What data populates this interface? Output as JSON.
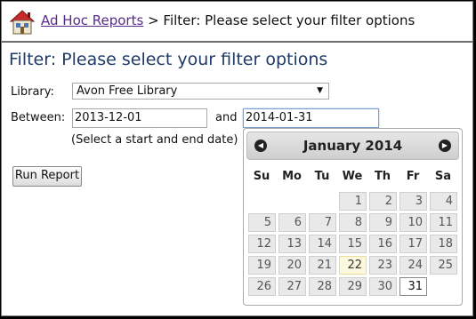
{
  "breadcrumb": {
    "link": "Ad Hoc Reports",
    "rest": " > Filter: Please select your filter options"
  },
  "page_title": "Filter: Please select your filter options",
  "form": {
    "library_label": "Library:",
    "library_value": "Avon Free Library",
    "between_label": "Between:",
    "start_date": "2013-12-01",
    "and_label": "and",
    "end_date": "2014-01-31",
    "hint": "(Select a start and end date)",
    "run_button": "Run Report"
  },
  "datepicker": {
    "title": "January 2014",
    "weekdays": [
      "Su",
      "Mo",
      "Tu",
      "We",
      "Th",
      "Fr",
      "Sa"
    ],
    "weeks": [
      [
        "",
        "",
        "",
        "1",
        "2",
        "3",
        "4"
      ],
      [
        "5",
        "6",
        "7",
        "8",
        "9",
        "10",
        "11"
      ],
      [
        "12",
        "13",
        "14",
        "15",
        "16",
        "17",
        "18"
      ],
      [
        "19",
        "20",
        "21",
        "22",
        "23",
        "24",
        "25"
      ],
      [
        "26",
        "27",
        "28",
        "29",
        "30",
        "31",
        ""
      ]
    ],
    "today": "22",
    "selected": "31"
  },
  "colors": {
    "title": "#1f3a66",
    "link": "#5a2a8a",
    "today_bg": "#fcf8dd"
  }
}
